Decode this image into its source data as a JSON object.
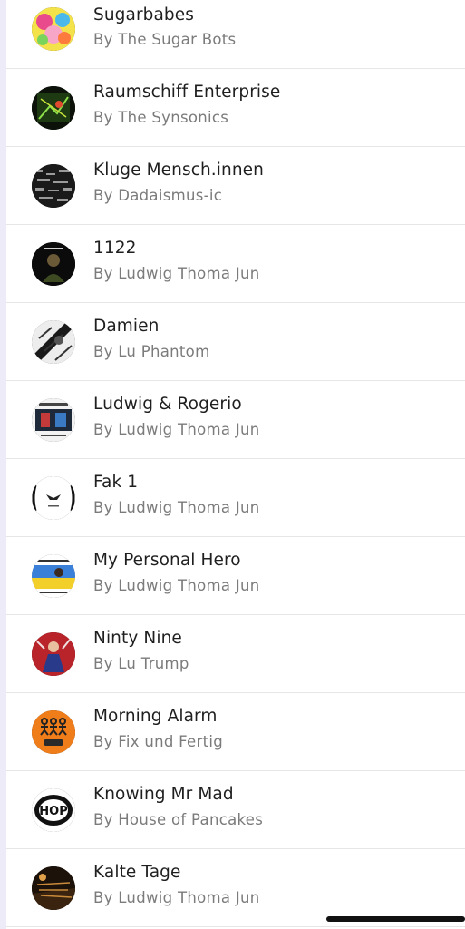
{
  "tracks": [
    {
      "title": "Sugarbabes",
      "artist": "By The Sugar Bots"
    },
    {
      "title": "Raumschiff Enterprise",
      "artist": "By The Synsonics"
    },
    {
      "title": "Kluge Mensch.innen",
      "artist": "By Dadaismus-ic"
    },
    {
      "title": "1122",
      "artist": "By Ludwig Thoma Jun"
    },
    {
      "title": "Damien",
      "artist": "By Lu Phantom"
    },
    {
      "title": "Ludwig & Rogerio",
      "artist": "By Ludwig Thoma Jun"
    },
    {
      "title": "Fak 1",
      "artist": "By Ludwig Thoma Jun"
    },
    {
      "title": "My Personal Hero",
      "artist": "By Ludwig Thoma Jun"
    },
    {
      "title": "Ninty Nine",
      "artist": "By Lu Trump"
    },
    {
      "title": "Morning Alarm",
      "artist": "By Fix und Fertig"
    },
    {
      "title": "Knowing Mr Mad",
      "artist": "By House of Pancakes"
    },
    {
      "title": "Kalte Tage",
      "artist": "By Ludwig Thoma Jun"
    }
  ],
  "artwork_labels": {
    "hop_logo": "HOP"
  },
  "colors": {
    "title_text": "#1f1f1f",
    "artist_text": "#7b7b7b",
    "divider": "#e6e6e6",
    "side_edge": "#ecebf7"
  }
}
